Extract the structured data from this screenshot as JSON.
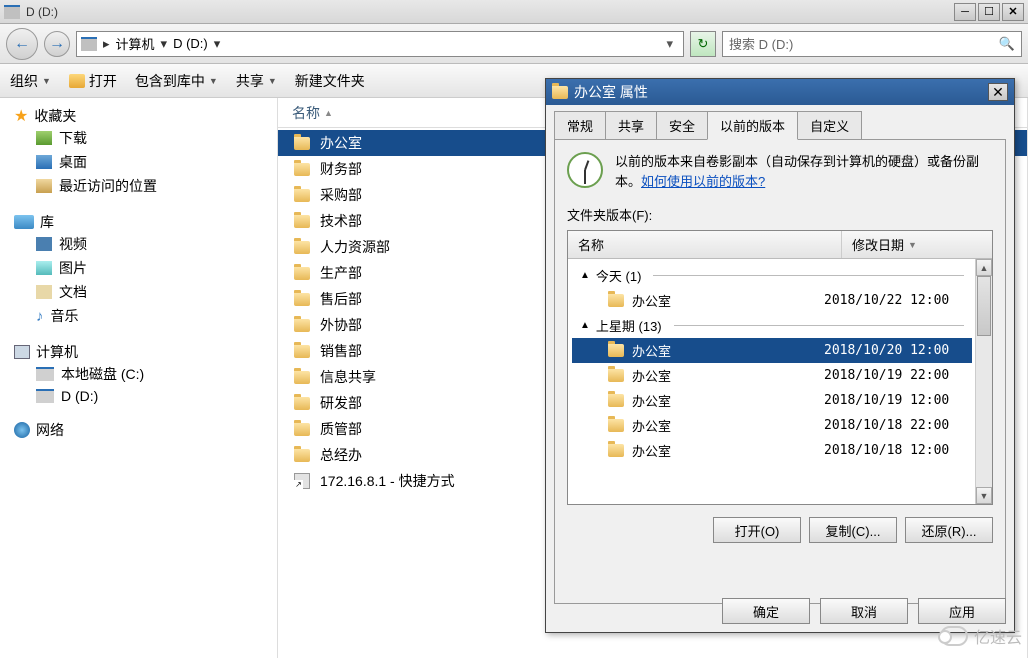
{
  "window": {
    "title": "D (D:)"
  },
  "nav": {
    "breadcrumb": [
      "计算机",
      "D (D:)"
    ],
    "search_placeholder": "搜索 D (D:)"
  },
  "toolbar": {
    "organize": "组织",
    "open": "打开",
    "include": "包含到库中",
    "share": "共享",
    "newfolder": "新建文件夹"
  },
  "sidebar": {
    "favorites": {
      "label": "收藏夹",
      "items": [
        "下载",
        "桌面",
        "最近访问的位置"
      ]
    },
    "library": {
      "label": "库",
      "items": [
        "视频",
        "图片",
        "文档",
        "音乐"
      ]
    },
    "computer": {
      "label": "计算机",
      "items": [
        "本地磁盘 (C:)",
        "D (D:)"
      ]
    },
    "network": {
      "label": "网络"
    }
  },
  "filelist": {
    "header": "名称",
    "items": [
      {
        "name": "办公室",
        "type": "folder",
        "selected": true
      },
      {
        "name": "财务部",
        "type": "folder"
      },
      {
        "name": "采购部",
        "type": "folder"
      },
      {
        "name": "技术部",
        "type": "folder"
      },
      {
        "name": "人力资源部",
        "type": "folder"
      },
      {
        "name": "生产部",
        "type": "folder"
      },
      {
        "name": "售后部",
        "type": "folder"
      },
      {
        "name": "外协部",
        "type": "folder"
      },
      {
        "name": "销售部",
        "type": "folder"
      },
      {
        "name": "信息共享",
        "type": "folder"
      },
      {
        "name": "研发部",
        "type": "folder"
      },
      {
        "name": "质管部",
        "type": "folder"
      },
      {
        "name": "总经办",
        "type": "folder"
      },
      {
        "name": "172.16.8.1 - 快捷方式",
        "type": "shortcut"
      }
    ]
  },
  "dialog": {
    "title": "办公室 属性",
    "tabs": [
      "常规",
      "共享",
      "安全",
      "以前的版本",
      "自定义"
    ],
    "active_tab": 3,
    "info_text_1": "以前的版本来自卷影副本（自动保存到计算机的硬盘）或备份副本。",
    "info_link": "如何使用以前的版本?",
    "list_label": "文件夹版本(F):",
    "columns": {
      "name": "名称",
      "date": "修改日期"
    },
    "groups": [
      {
        "label": "今天 (1)",
        "items": [
          {
            "name": "办公室",
            "date": "2018/10/22 12:00"
          }
        ]
      },
      {
        "label": "上星期 (13)",
        "items": [
          {
            "name": "办公室",
            "date": "2018/10/20 12:00",
            "selected": true
          },
          {
            "name": "办公室",
            "date": "2018/10/19 22:00"
          },
          {
            "name": "办公室",
            "date": "2018/10/19 12:00"
          },
          {
            "name": "办公室",
            "date": "2018/10/18 22:00"
          },
          {
            "name": "办公室",
            "date": "2018/10/18 12:00"
          }
        ]
      }
    ],
    "buttons": {
      "open": "打开(O)",
      "copy": "复制(C)...",
      "restore": "还原(R)..."
    },
    "footer": {
      "ok": "确定",
      "cancel": "取消",
      "apply": "应用"
    }
  },
  "watermark": "亿速云"
}
